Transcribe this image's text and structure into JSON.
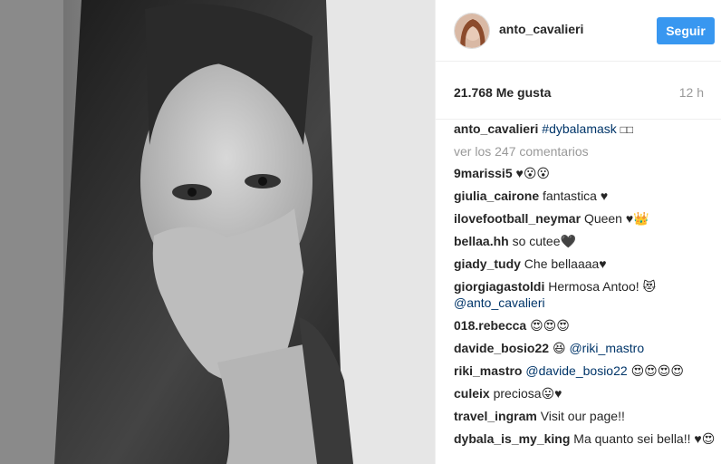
{
  "post": {
    "username": "anto_cavalieri",
    "follow_label": "Seguir",
    "likes": "21.768 Me gusta",
    "time": "12 h"
  },
  "caption": {
    "user": "anto_cavalieri",
    "hashtag": "#dybalamask",
    "emoji": "□□"
  },
  "more_comments": "ver los 247 comentarios",
  "comments": [
    {
      "user": "9marissi5",
      "text": "♥😮😮"
    },
    {
      "user": "giulia_cairone",
      "text": "fantastica ♥"
    },
    {
      "user": "ilovefootball_neymar",
      "text": "Queen ♥👑"
    },
    {
      "user": "bellaa.hh",
      "text": "so cutee🖤"
    },
    {
      "user": "giady_tudy",
      "text": "Che bellaaaa♥"
    },
    {
      "user": "giorgiagastoldi",
      "text": "Hermosa Antoo! 😻",
      "mention": "@anto_cavalieri"
    },
    {
      "user": "018.rebecca",
      "text": "😍😍😍"
    },
    {
      "user": "davide_bosio22",
      "text": "😆",
      "mention": "@riki_mastro"
    },
    {
      "user": "riki_mastro",
      "mention": "@davide_bosio22",
      "text": "😍😍😍😍"
    },
    {
      "user": "culeix",
      "text": "preciosa😛♥"
    },
    {
      "user": "travel_ingram",
      "text": "Visit our page!!"
    },
    {
      "user": "dybala_is_my_king",
      "text": "Ma quanto sei bella!! ♥😍"
    }
  ]
}
